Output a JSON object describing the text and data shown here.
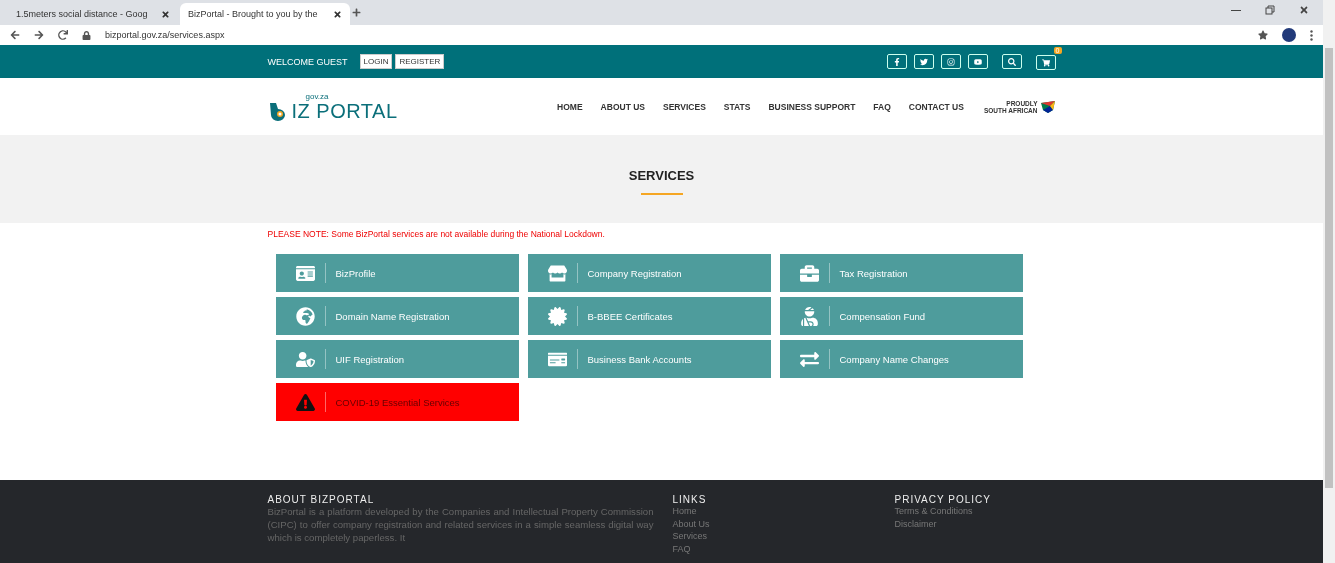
{
  "browser": {
    "tabs": [
      {
        "label": "1.5meters social distance - Goog",
        "selected": false
      },
      {
        "label": "BizPortal - Brought to you by the",
        "selected": true
      }
    ],
    "url": "bizportal.gov.za/services.aspx"
  },
  "topbar": {
    "welcome": "WELCOME GUEST",
    "buttons": [
      "LOGIN",
      "REGISTER"
    ],
    "cart_count": "0"
  },
  "logo": {
    "domain": "gov.za",
    "name": "IZ PORTAL",
    "badge_top": "PROUDLY",
    "badge_bottom": "SOUTH AFRICAN"
  },
  "nav": [
    {
      "label": "HOME",
      "selected": false
    },
    {
      "label": "ABOUT US",
      "selected": false
    },
    {
      "label": "SERVICES",
      "selected": false
    },
    {
      "label": "STATS",
      "selected": false
    },
    {
      "label": "BUSINESS SUPPORT",
      "selected": false
    },
    {
      "label": "FAQ",
      "selected": false
    },
    {
      "label": "CONTACT US",
      "selected": false
    }
  ],
  "hero": {
    "title": "SERVICES"
  },
  "notice": "PLEASE NOTE: Some BizPortal services are not available during the National Lockdown.",
  "services": [
    {
      "label": "BizProfile",
      "kind": "service"
    },
    {
      "label": "Company Registration",
      "kind": "service"
    },
    {
      "label": "Tax Registration",
      "kind": "service"
    },
    {
      "label": "Domain Name Registration",
      "kind": "service"
    },
    {
      "label": "B-BBEE Certificates",
      "kind": "service"
    },
    {
      "label": "Compensation Fund",
      "kind": "service"
    },
    {
      "label": "UIF Registration",
      "kind": "service"
    },
    {
      "label": "Business Bank Accounts",
      "kind": "service"
    },
    {
      "label": "Company Name Changes",
      "kind": "service"
    },
    {
      "label": "COVID-19 Essential Services",
      "kind": "alert"
    }
  ],
  "footer": {
    "about": {
      "title": "ABOUT BIZPORTAL",
      "text": "BizPortal is a platform developed by the Companies and Intellectual Property Commission (CIPC) to offer company registration and related services in a simple seamless digital way which is completely paperless. It"
    },
    "links": {
      "title": "LINKS",
      "items": [
        "Home",
        "About Us",
        "Services",
        "FAQ"
      ]
    },
    "privacy": {
      "title": "PRIVACY POLICY",
      "items": [
        "Terms & Conditions",
        "Disclaimer"
      ]
    }
  }
}
